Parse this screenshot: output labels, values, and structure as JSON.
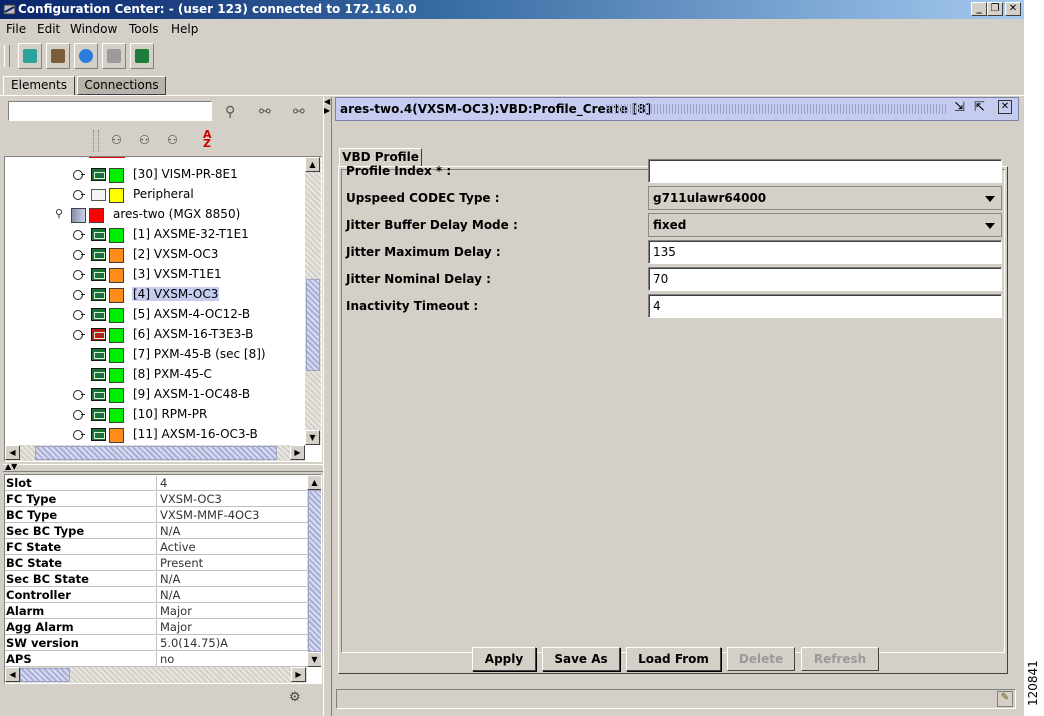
{
  "window": {
    "title": "Configuration Center: - (user 123) connected to 172.16.0.0"
  },
  "menu": [
    "File",
    "Edit",
    "Window",
    "Tools",
    "Help"
  ],
  "toolbar_icons": [
    "cube-icon",
    "chip-icon",
    "shield-icon",
    "copy-icon",
    "export-icon"
  ],
  "tabs": {
    "elements": "Elements",
    "connections": "Connections"
  },
  "tree": {
    "search_value": "",
    "items": [
      {
        "label": "[30] VISM-PR-8E1",
        "color": "#00ee00"
      },
      {
        "label": "Peripheral",
        "color": "#ffff00"
      },
      {
        "label": "ares-two (MGX 8850)",
        "color": "#ff0000"
      },
      {
        "label": "[1] AXSME-32-T1E1",
        "color": "#00ee00"
      },
      {
        "label": "[2] VXSM-OC3",
        "color": "#ff8c1a"
      },
      {
        "label": "[3] VXSM-T1E1",
        "color": "#ff8c1a"
      },
      {
        "label": "[4] VXSM-OC3",
        "color": "#ff8c1a"
      },
      {
        "label": "[5] AXSM-4-OC12-B",
        "color": "#00ee00"
      },
      {
        "label": "[6] AXSM-16-T3E3-B",
        "color": "#00ee00"
      },
      {
        "label": "[7] PXM-45-B (sec [8])",
        "color": "#00ee00"
      },
      {
        "label": "[8] PXM-45-C",
        "color": "#00ee00"
      },
      {
        "label": "[9] AXSM-1-OC48-B",
        "color": "#00ee00"
      },
      {
        "label": "[10] RPM-PR",
        "color": "#00ee00"
      },
      {
        "label": "[11] AXSM-16-OC3-B",
        "color": "#ff8c1a"
      }
    ]
  },
  "properties": [
    {
      "key": "Slot",
      "value": "4"
    },
    {
      "key": "FC Type",
      "value": "VXSM-OC3"
    },
    {
      "key": "BC Type",
      "value": "VXSM-MMF-4OC3"
    },
    {
      "key": "Sec BC Type",
      "value": "N/A"
    },
    {
      "key": "FC State",
      "value": "Active"
    },
    {
      "key": "BC State",
      "value": "Present"
    },
    {
      "key": "Sec BC State",
      "value": "N/A"
    },
    {
      "key": "Controller",
      "value": "N/A"
    },
    {
      "key": "Alarm",
      "value": "Major"
    },
    {
      "key": "Agg Alarm",
      "value": "Major"
    },
    {
      "key": "SW version",
      "value": "5.0(14.75)A"
    },
    {
      "key": "APS",
      "value": "no"
    }
  ],
  "panel": {
    "title": "ares-two.4(VXSM-OC3):VBD:Profile_Create [8]",
    "tab": "VBD Profile",
    "fields": {
      "profile_index": {
        "label": "Profile Index * :",
        "value": ""
      },
      "upspeed_codec": {
        "label": "Upspeed CODEC Type :",
        "value": "g711ulawr64000"
      },
      "jitter_mode": {
        "label": "Jitter Buffer Delay Mode :",
        "value": "fixed"
      },
      "jitter_max": {
        "label": "Jitter Maximum Delay :",
        "value": "135"
      },
      "jitter_nominal": {
        "label": "Jitter Nominal Delay :",
        "value": "70"
      },
      "inactivity": {
        "label": "Inactivity Timeout :",
        "value": "4"
      }
    },
    "buttons": {
      "apply": "Apply",
      "save_as": "Save As",
      "load_from": "Load From",
      "delete": "Delete",
      "refresh": "Refresh"
    }
  },
  "figure_id": "120841"
}
